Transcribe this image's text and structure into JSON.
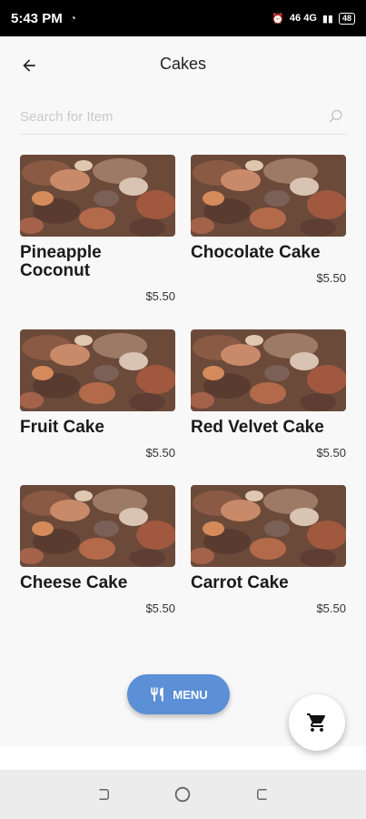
{
  "status_bar": {
    "time": "5:43 PM",
    "left_icon": "data-saver-icon",
    "right_text": "46 4G",
    "battery": "48"
  },
  "app_bar": {
    "title": "Cakes",
    "back_icon": "arrow-back-icon"
  },
  "search": {
    "placeholder": "Search for Item",
    "icon": "search-icon"
  },
  "items": [
    {
      "name": "Pineapple Coconut",
      "price": "$5.50"
    },
    {
      "name": "Chocolate Cake",
      "price": "$5.50"
    },
    {
      "name": "Fruit Cake",
      "price": "$5.50"
    },
    {
      "name": "Red Velvet Cake",
      "price": "$5.50"
    },
    {
      "name": "Cheese Cake",
      "price": "$5.50"
    },
    {
      "name": "Carrot Cake",
      "price": "$5.50"
    }
  ],
  "menu_button": {
    "label": "MENU",
    "icon": "restaurant-icon",
    "color": "#5b8fd6"
  },
  "cart_button": {
    "icon": "cart-icon"
  },
  "nav_bar": {
    "icons": [
      "recent-apps-icon",
      "home-icon",
      "back-icon"
    ]
  }
}
